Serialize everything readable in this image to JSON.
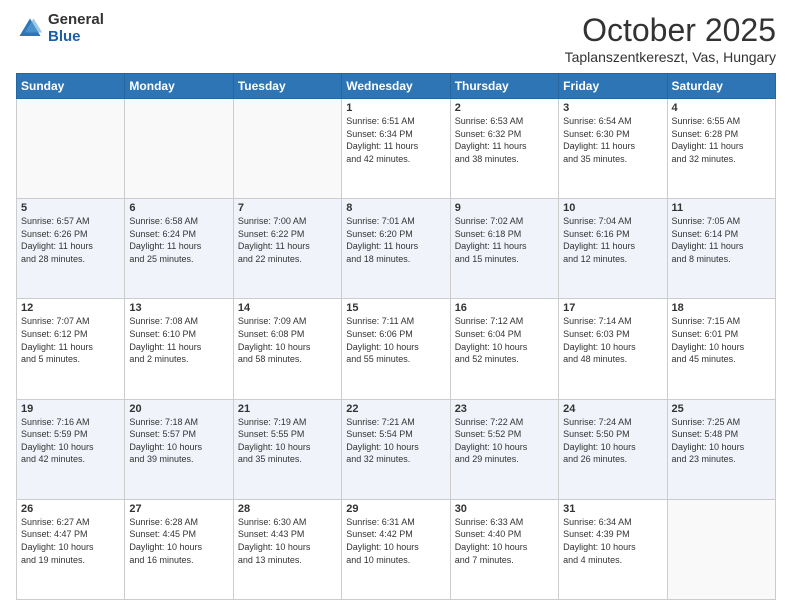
{
  "logo": {
    "general": "General",
    "blue": "Blue"
  },
  "header": {
    "month": "October 2025",
    "location": "Taplanszentkereszt, Vas, Hungary"
  },
  "days_of_week": [
    "Sunday",
    "Monday",
    "Tuesday",
    "Wednesday",
    "Thursday",
    "Friday",
    "Saturday"
  ],
  "weeks": [
    [
      {
        "day": "",
        "info": ""
      },
      {
        "day": "",
        "info": ""
      },
      {
        "day": "",
        "info": ""
      },
      {
        "day": "1",
        "info": "Sunrise: 6:51 AM\nSunset: 6:34 PM\nDaylight: 11 hours\nand 42 minutes."
      },
      {
        "day": "2",
        "info": "Sunrise: 6:53 AM\nSunset: 6:32 PM\nDaylight: 11 hours\nand 38 minutes."
      },
      {
        "day": "3",
        "info": "Sunrise: 6:54 AM\nSunset: 6:30 PM\nDaylight: 11 hours\nand 35 minutes."
      },
      {
        "day": "4",
        "info": "Sunrise: 6:55 AM\nSunset: 6:28 PM\nDaylight: 11 hours\nand 32 minutes."
      }
    ],
    [
      {
        "day": "5",
        "info": "Sunrise: 6:57 AM\nSunset: 6:26 PM\nDaylight: 11 hours\nand 28 minutes."
      },
      {
        "day": "6",
        "info": "Sunrise: 6:58 AM\nSunset: 6:24 PM\nDaylight: 11 hours\nand 25 minutes."
      },
      {
        "day": "7",
        "info": "Sunrise: 7:00 AM\nSunset: 6:22 PM\nDaylight: 11 hours\nand 22 minutes."
      },
      {
        "day": "8",
        "info": "Sunrise: 7:01 AM\nSunset: 6:20 PM\nDaylight: 11 hours\nand 18 minutes."
      },
      {
        "day": "9",
        "info": "Sunrise: 7:02 AM\nSunset: 6:18 PM\nDaylight: 11 hours\nand 15 minutes."
      },
      {
        "day": "10",
        "info": "Sunrise: 7:04 AM\nSunset: 6:16 PM\nDaylight: 11 hours\nand 12 minutes."
      },
      {
        "day": "11",
        "info": "Sunrise: 7:05 AM\nSunset: 6:14 PM\nDaylight: 11 hours\nand 8 minutes."
      }
    ],
    [
      {
        "day": "12",
        "info": "Sunrise: 7:07 AM\nSunset: 6:12 PM\nDaylight: 11 hours\nand 5 minutes."
      },
      {
        "day": "13",
        "info": "Sunrise: 7:08 AM\nSunset: 6:10 PM\nDaylight: 11 hours\nand 2 minutes."
      },
      {
        "day": "14",
        "info": "Sunrise: 7:09 AM\nSunset: 6:08 PM\nDaylight: 10 hours\nand 58 minutes."
      },
      {
        "day": "15",
        "info": "Sunrise: 7:11 AM\nSunset: 6:06 PM\nDaylight: 10 hours\nand 55 minutes."
      },
      {
        "day": "16",
        "info": "Sunrise: 7:12 AM\nSunset: 6:04 PM\nDaylight: 10 hours\nand 52 minutes."
      },
      {
        "day": "17",
        "info": "Sunrise: 7:14 AM\nSunset: 6:03 PM\nDaylight: 10 hours\nand 48 minutes."
      },
      {
        "day": "18",
        "info": "Sunrise: 7:15 AM\nSunset: 6:01 PM\nDaylight: 10 hours\nand 45 minutes."
      }
    ],
    [
      {
        "day": "19",
        "info": "Sunrise: 7:16 AM\nSunset: 5:59 PM\nDaylight: 10 hours\nand 42 minutes."
      },
      {
        "day": "20",
        "info": "Sunrise: 7:18 AM\nSunset: 5:57 PM\nDaylight: 10 hours\nand 39 minutes."
      },
      {
        "day": "21",
        "info": "Sunrise: 7:19 AM\nSunset: 5:55 PM\nDaylight: 10 hours\nand 35 minutes."
      },
      {
        "day": "22",
        "info": "Sunrise: 7:21 AM\nSunset: 5:54 PM\nDaylight: 10 hours\nand 32 minutes."
      },
      {
        "day": "23",
        "info": "Sunrise: 7:22 AM\nSunset: 5:52 PM\nDaylight: 10 hours\nand 29 minutes."
      },
      {
        "day": "24",
        "info": "Sunrise: 7:24 AM\nSunset: 5:50 PM\nDaylight: 10 hours\nand 26 minutes."
      },
      {
        "day": "25",
        "info": "Sunrise: 7:25 AM\nSunset: 5:48 PM\nDaylight: 10 hours\nand 23 minutes."
      }
    ],
    [
      {
        "day": "26",
        "info": "Sunrise: 6:27 AM\nSunset: 4:47 PM\nDaylight: 10 hours\nand 19 minutes."
      },
      {
        "day": "27",
        "info": "Sunrise: 6:28 AM\nSunset: 4:45 PM\nDaylight: 10 hours\nand 16 minutes."
      },
      {
        "day": "28",
        "info": "Sunrise: 6:30 AM\nSunset: 4:43 PM\nDaylight: 10 hours\nand 13 minutes."
      },
      {
        "day": "29",
        "info": "Sunrise: 6:31 AM\nSunset: 4:42 PM\nDaylight: 10 hours\nand 10 minutes."
      },
      {
        "day": "30",
        "info": "Sunrise: 6:33 AM\nSunset: 4:40 PM\nDaylight: 10 hours\nand 7 minutes."
      },
      {
        "day": "31",
        "info": "Sunrise: 6:34 AM\nSunset: 4:39 PM\nDaylight: 10 hours\nand 4 minutes."
      },
      {
        "day": "",
        "info": ""
      }
    ]
  ]
}
